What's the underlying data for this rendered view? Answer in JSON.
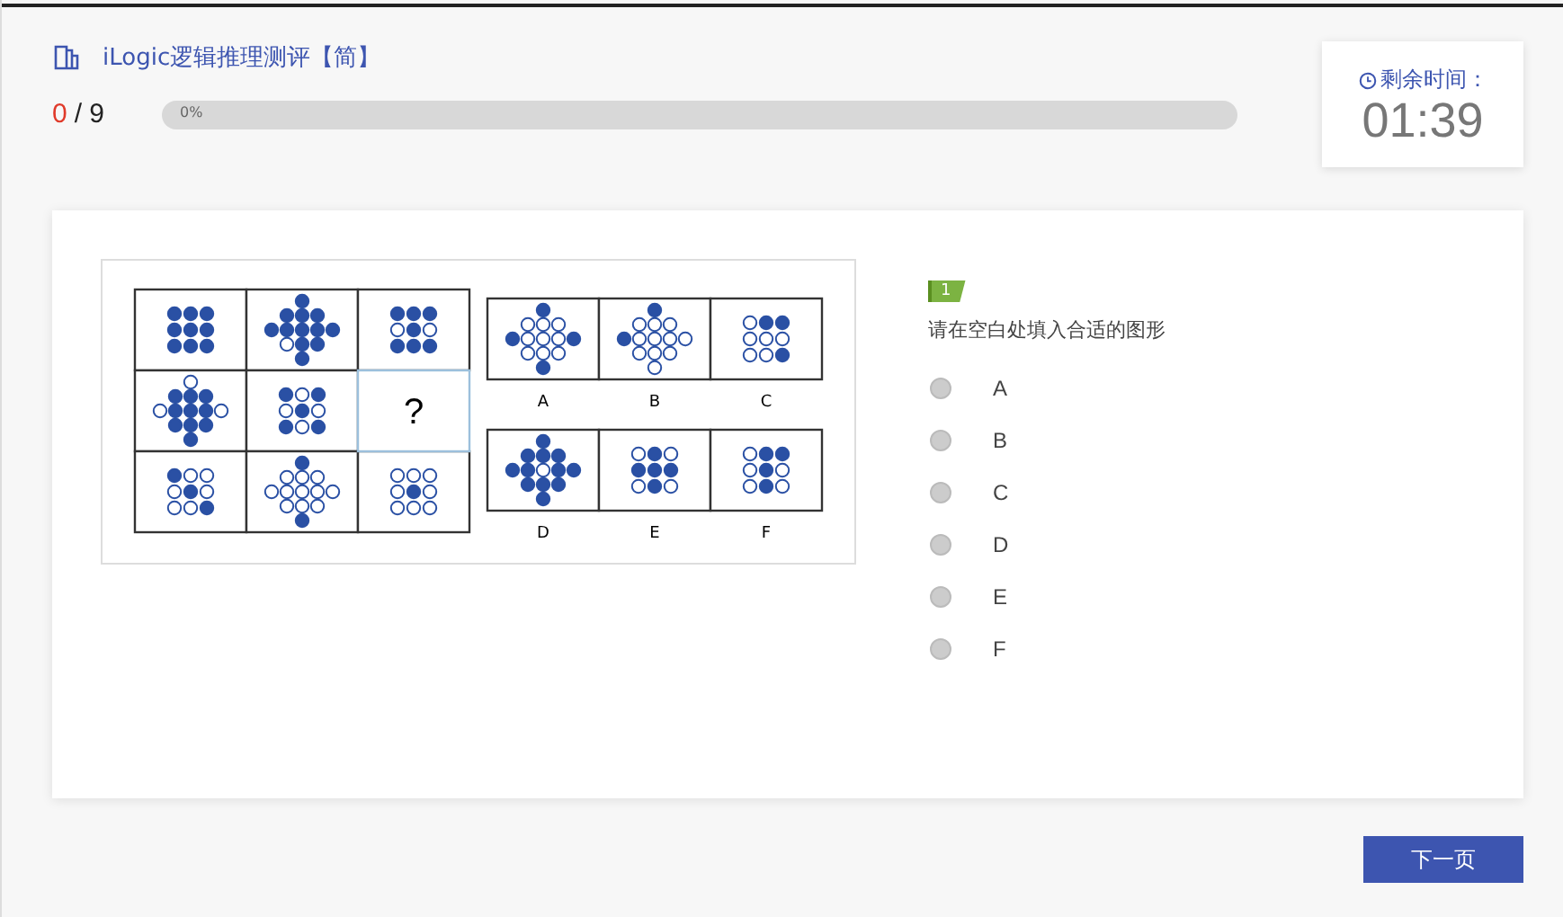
{
  "header": {
    "title": "iLogic逻辑推理测评【简】",
    "answered": "0",
    "total": "/ 9",
    "progress": {
      "label": "0%",
      "level": 0
    }
  },
  "timer": {
    "label": "剩余时间：",
    "value": "01:39"
  },
  "question": {
    "number": "1",
    "text": "请在空白处填入合适的图形",
    "figure": {
      "blank": "?",
      "option_labels": [
        "A",
        "B",
        "C",
        "D",
        "E",
        "F"
      ]
    },
    "options": [
      {
        "label": "A",
        "selected": false
      },
      {
        "label": "B",
        "selected": false
      },
      {
        "label": "C",
        "selected": false
      },
      {
        "label": "D",
        "selected": false
      },
      {
        "label": "E",
        "selected": false
      },
      {
        "label": "F",
        "selected": false
      }
    ]
  },
  "next_button": "下一页"
}
